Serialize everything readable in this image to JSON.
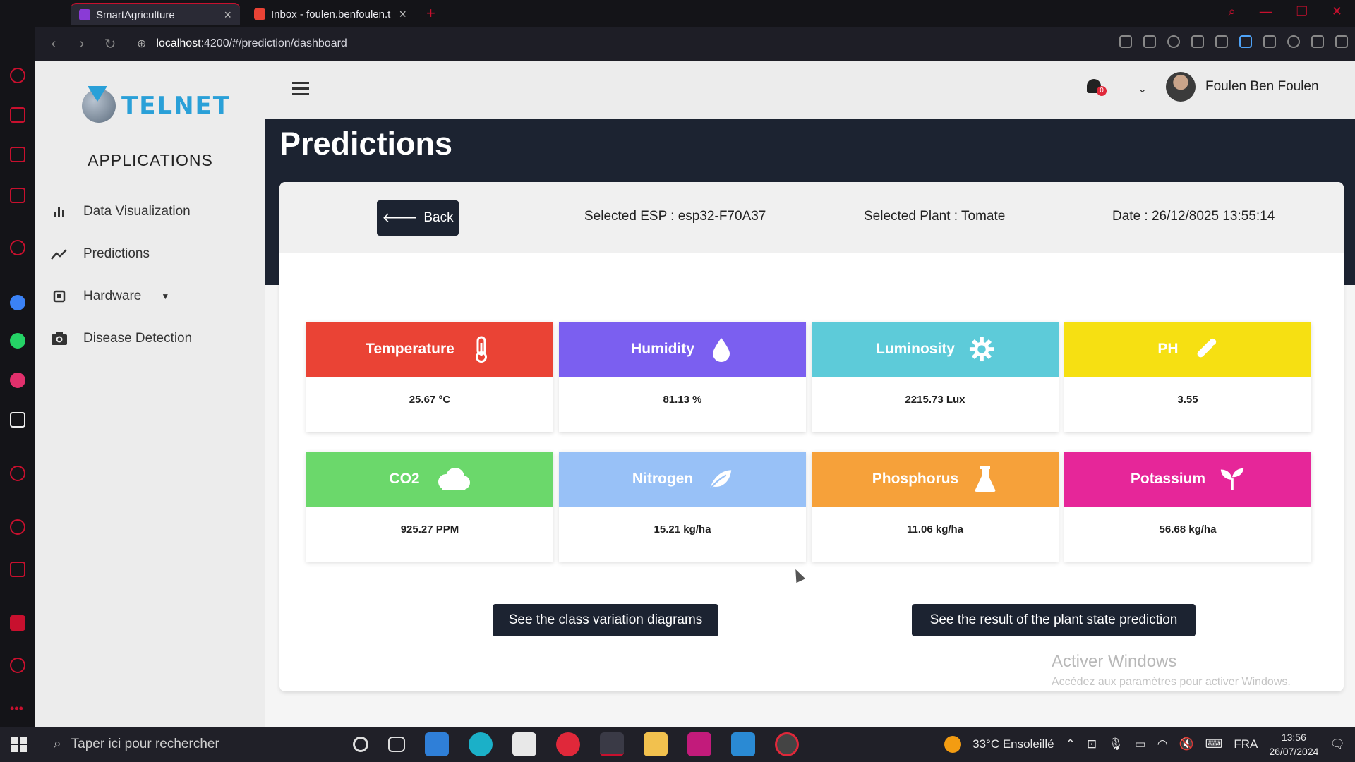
{
  "browser": {
    "tabs": [
      {
        "label": "SmartAgriculture"
      },
      {
        "label": "Inbox - foulen.benfoulen.t"
      }
    ],
    "url_host": "localhost",
    "url_path": ":4200/#/prediction/dashboard"
  },
  "sidebar": {
    "logo_text": "TELNET",
    "section_title": "APPLICATIONS",
    "items": [
      {
        "label": "Data Visualization",
        "icon": "bar-chart-icon"
      },
      {
        "label": "Predictions",
        "icon": "trend-line-icon"
      },
      {
        "label": "Hardware",
        "icon": "chip-icon"
      },
      {
        "label": "Disease Detection",
        "icon": "camera-icon"
      }
    ]
  },
  "header": {
    "notification_count": "0",
    "username": "Foulen Ben Foulen"
  },
  "page": {
    "title": "Predictions",
    "back_label": "Back",
    "selected_esp": "Selected ESP : esp32-F70A37",
    "selected_plant": "Selected Plant : Tomate",
    "date": "Date : 26/12/8025 13:55:14"
  },
  "metrics": [
    {
      "label": "Temperature",
      "value": "25.67 °C",
      "color": "#ea4335",
      "icon": "thermometer-icon"
    },
    {
      "label": "Humidity",
      "value": "81.13 %",
      "color": "#7b5ff0",
      "icon": "water-drop-icon"
    },
    {
      "label": "Luminosity",
      "value": "2215.73 Lux",
      "color": "#5dcbd9",
      "icon": "sun-gear-icon"
    },
    {
      "label": "PH",
      "value": "3.55",
      "color": "#f6e012",
      "icon": "eyedropper-icon"
    },
    {
      "label": "CO2",
      "value": "925.27 PPM",
      "color": "#6bd86b",
      "icon": "cloud-icon"
    },
    {
      "label": "Nitrogen",
      "value": "15.21 kg/ha",
      "color": "#98c1f7",
      "icon": "leaf-icon"
    },
    {
      "label": "Phosphorus",
      "value": "11.06 kg/ha",
      "color": "#f6a13a",
      "icon": "flask-icon"
    },
    {
      "label": "Potassium",
      "value": "56.68 kg/ha",
      "color": "#e62699",
      "icon": "sprout-icon"
    }
  ],
  "actions": {
    "class_variation": "See the class variation diagrams",
    "plant_state": "See the result of the plant state prediction"
  },
  "watermark": {
    "line1": "Activer Windows",
    "line2": "Accédez aux paramètres pour activer Windows."
  },
  "taskbar": {
    "search_placeholder": "Taper ici pour rechercher",
    "weather": "33°C  Ensoleillé",
    "language": "FRA",
    "time": "13:56",
    "date": "26/07/2024"
  }
}
